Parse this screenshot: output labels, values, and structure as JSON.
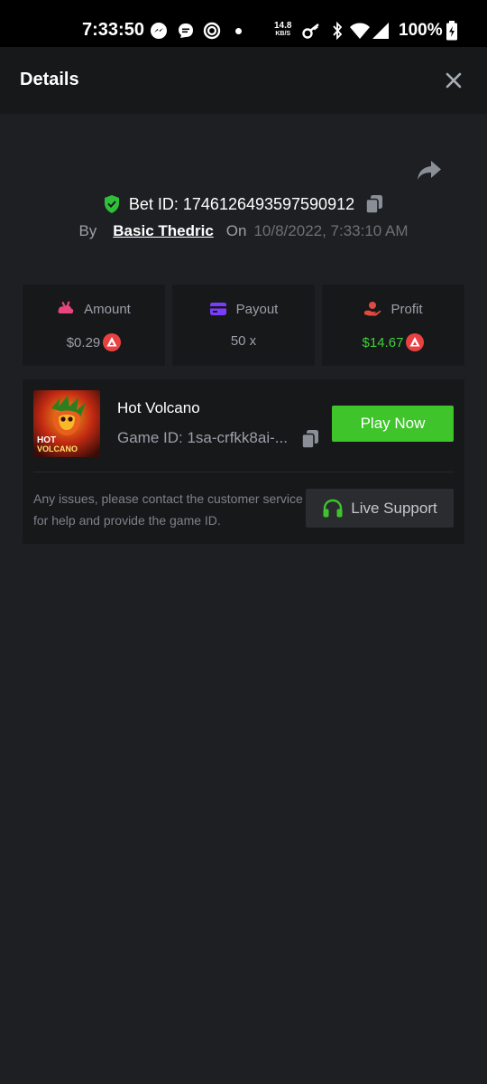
{
  "status_bar": {
    "time": "7:33:50",
    "net_speed_value": "14.8",
    "net_speed_unit": "KB/S",
    "battery": "100%",
    "icons": [
      "messenger-icon",
      "chat-icon",
      "app-icon",
      "dot-icon",
      "key-icon",
      "bluetooth-icon",
      "wifi-icon",
      "signal-icon",
      "battery-charging-icon"
    ]
  },
  "header": {
    "title": "Details",
    "close_icon": "close-icon"
  },
  "bet": {
    "id_text": "Bet ID: 1746126493597590912",
    "by_label": "By",
    "username": "Basic Thedric",
    "on_label": "On",
    "datetime": "10/8/2022, 7:33:10 AM",
    "icons": [
      "share-icon",
      "shield-check-icon",
      "copy-icon"
    ]
  },
  "stats": [
    {
      "label": "Amount",
      "value": "$0.29",
      "icon": "amount-icon",
      "coin": "avax-coin-icon",
      "color": "#9aa0a8"
    },
    {
      "label": "Payout",
      "value": "50 x",
      "icon": "wallet-icon",
      "color": "#9aa0a8"
    },
    {
      "label": "Profit",
      "value": "$14.67",
      "icon": "profit-icon",
      "coin": "avax-coin-icon",
      "color": "#3fd13a"
    }
  ],
  "game": {
    "name": "Hot Volcano",
    "id_text": "Game ID: 1sa-crfkk8ai-...",
    "thumb_text_line1": "HOT",
    "thumb_text_line2": "VOLCANO",
    "play_label": "Play Now",
    "help_text": "Any issues, please contact the customer service for help and provide the game ID.",
    "support_label": "Live Support"
  },
  "colors": {
    "accent_green": "#3fc42c",
    "profit_green": "#3fd13a",
    "coin_red": "#e84142",
    "wallet_purple": "#7b3cff",
    "amount_pink": "#e8457e",
    "profit_red": "#e04a3f",
    "background": "#1e1f22",
    "card": "#17181a"
  }
}
